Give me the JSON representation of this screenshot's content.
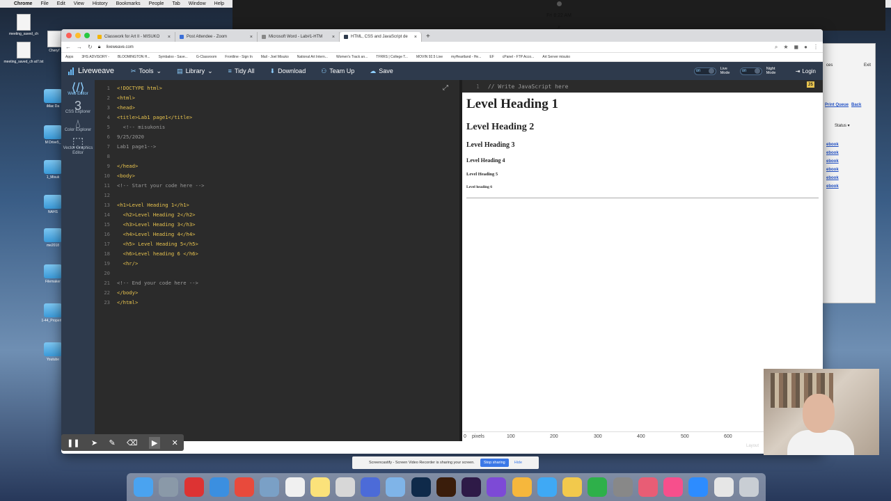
{
  "menubar": {
    "app": "Chrome",
    "items": [
      "File",
      "Edit",
      "View",
      "History",
      "Bookmarks",
      "People",
      "Tab",
      "Window",
      "Help"
    ],
    "clock": "Fri 8:22 AM"
  },
  "desktop": {
    "items": [
      {
        "label": "meeting_saved_ch"
      },
      {
        "label": "Cheryl'"
      },
      {
        "label": "meeting_saved_ch at7.txt"
      },
      {
        "label": "iMac Da"
      },
      {
        "label": "M Drive5_"
      },
      {
        "label": "1_Misuk"
      },
      {
        "label": "NAHS"
      },
      {
        "label": "me2018"
      },
      {
        "label": "Filemaker"
      },
      {
        "label": "1-44_Propertie"
      },
      {
        "label": "Youtube"
      }
    ]
  },
  "browser": {
    "tabs": [
      {
        "title": "Classwork for Art II - MISUKO"
      },
      {
        "title": "Post Attendee - Zoom"
      },
      {
        "title": "Microsoft Word - Lab#1-HTM"
      },
      {
        "title": "HTML, CSS and JavaScript de"
      }
    ],
    "url": "liveweave.com",
    "bookmarks": [
      "Apps",
      "3HS ADVISORY -",
      "BLOOMINGTON H...",
      "Symbaloo - Save...",
      "G-Classroom",
      "Frontline - Sign In",
      "Mail - Joel Misuko",
      "National Art Intern...",
      "Women's Track an...",
      "TFRRS | College T...",
      "MOVIN 92.5 Live",
      "myHeartland - He...",
      "EF",
      "cPanel - FTP Acco...",
      "Art Server misuko"
    ]
  },
  "liveweave": {
    "logo": "Liveweave",
    "toolbar": [
      "Tools",
      "Library",
      "Tidy All",
      "Download",
      "Team Up",
      "Save"
    ],
    "toggles": [
      {
        "state": "on",
        "label": "Live Mode"
      },
      {
        "state": "on",
        "label": "Night Mode"
      }
    ],
    "login": "Login",
    "sidebar": [
      {
        "label": "Web Editor",
        "icon": "html5-icon"
      },
      {
        "label": "CSS Explorer",
        "icon": "css3-icon"
      },
      {
        "label": "Color Explorer",
        "icon": "droplet-icon"
      },
      {
        "label": "Vector Graphics Editor",
        "icon": "vector-icon"
      }
    ],
    "code_lines": [
      {
        "n": "1",
        "text": "<!DOCTYPE html>"
      },
      {
        "n": "2",
        "text": "<html>"
      },
      {
        "n": "3",
        "text": "<head>"
      },
      {
        "n": "4",
        "text": "<title>Lab1 page1</title>"
      },
      {
        "n": "5",
        "text": "  <!-- misukonis"
      },
      {
        "n": "6",
        "text": "9/25/2020"
      },
      {
        "n": "7",
        "text": "Lab1 page1-->"
      },
      {
        "n": "8",
        "text": ""
      },
      {
        "n": "9",
        "text": "</head>"
      },
      {
        "n": "10",
        "text": "<body>"
      },
      {
        "n": "11",
        "text": "<!-- Start your code here -->"
      },
      {
        "n": "12",
        "text": ""
      },
      {
        "n": "13",
        "text": "<h1>Level Heading 1</h1>"
      },
      {
        "n": "14",
        "text": "  <h2>Level Heading 2</h2>"
      },
      {
        "n": "15",
        "text": "  <h3>Level Heading 3</h3>"
      },
      {
        "n": "16",
        "text": "  <h4>Level Heading 4</h4>"
      },
      {
        "n": "17",
        "text": "  <h5> Level Heading 5</h5>"
      },
      {
        "n": "18",
        "text": "  <h6>Level heading 6 </h6>"
      },
      {
        "n": "19",
        "text": "  <hr/>"
      },
      {
        "n": "20",
        "text": ""
      },
      {
        "n": "21",
        "text": "<!-- End your code here -->"
      },
      {
        "n": "22",
        "text": "</body>"
      },
      {
        "n": "23",
        "text": "</html>"
      }
    ],
    "js_line_number": "1",
    "js_placeholder": "// Write JavaScript here",
    "js_badge": "JS",
    "preview": {
      "h1": "Level Heading 1",
      "h2": "Level Heading 2",
      "h3": "Level Heading 3",
      "h4": "Level Heading 4",
      "h5": "Level Heading 5",
      "h6": "Level heading 6"
    },
    "ruler": [
      "0",
      "pixels",
      "100",
      "200",
      "300",
      "400",
      "500",
      "600"
    ],
    "layout_label": "Layout"
  },
  "side_window": {
    "items": [
      "Print Queue",
      "Back",
      "Status",
      "ebook",
      "ebook",
      "ebook",
      "ebook",
      "ebook",
      "ebook"
    ],
    "top_labels": [
      "ces",
      "Exit"
    ]
  },
  "screencastify": {
    "message": "Screencastify - Screen Video Recorder is sharing your screen.",
    "stop": "Stop sharing",
    "hide": "Hide"
  }
}
